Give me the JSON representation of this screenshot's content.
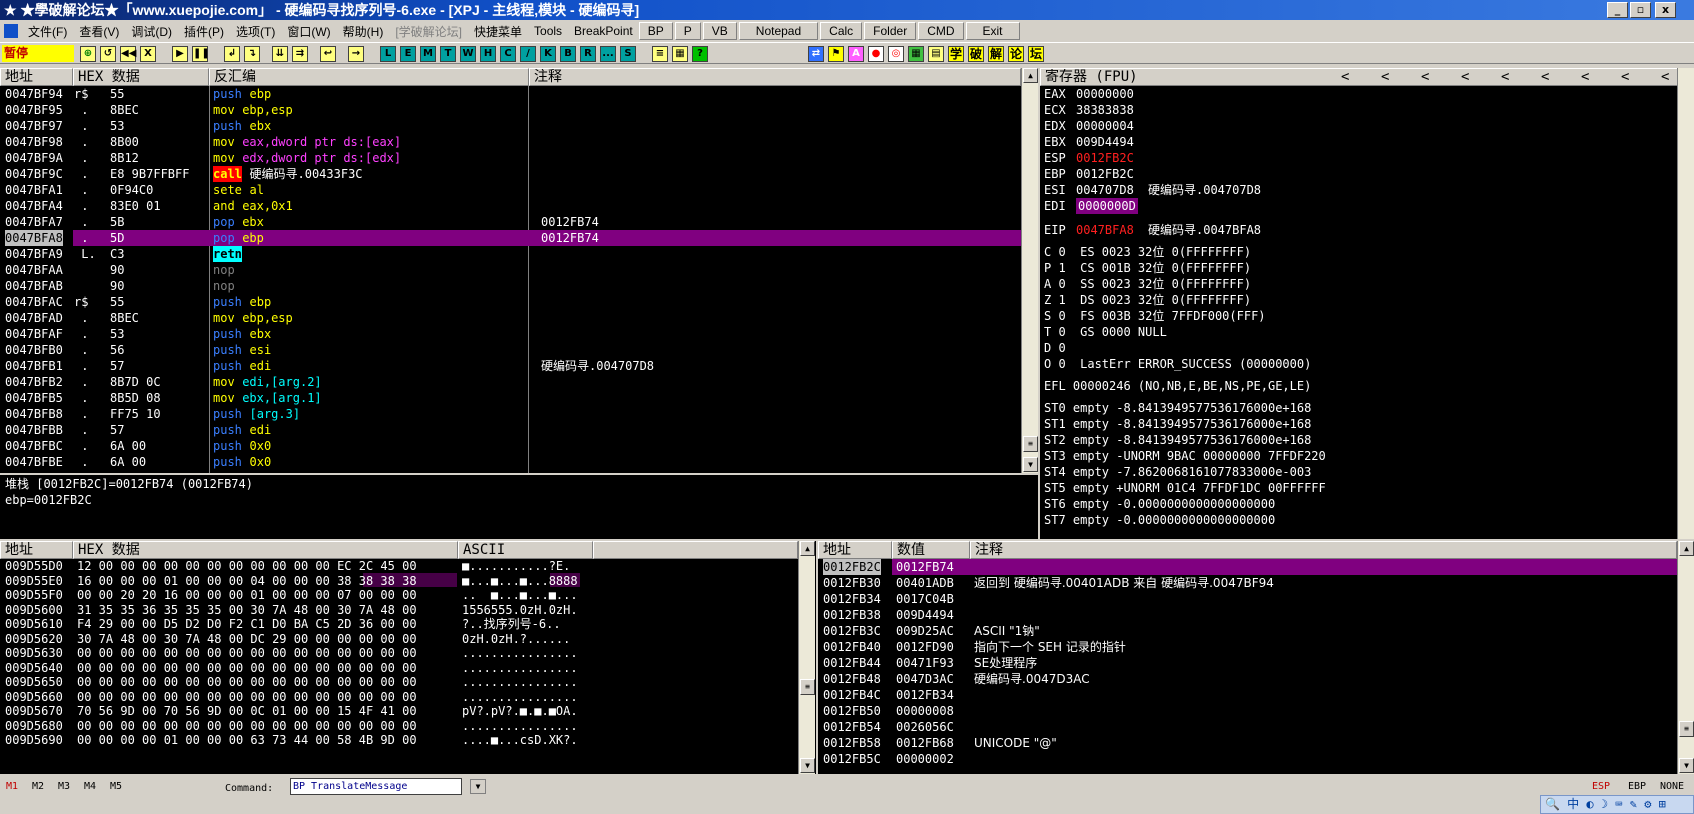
{
  "title": "★學破解论坛★「www.xuepojie.com」 - 硬编码寻找序列号-6.exe - [XPJ - 主线程,模块 - 硬编码寻]",
  "window_buttons": [
    "_",
    "▫",
    "x"
  ],
  "menu": [
    "文件(F)",
    "查看(V)",
    "调试(D)",
    "插件(P)",
    "选项(T)",
    "窗口(W)",
    "帮助(H)",
    "[学破解论坛]",
    "快捷菜单",
    "Tools",
    "BreakPoint"
  ],
  "menu_buttons": [
    "BP",
    "P",
    "VB",
    "Notepad",
    "Calc",
    "Folder",
    "CMD",
    "Exit"
  ],
  "status_paused": "暂停",
  "toolbar_letters": [
    "L",
    "E",
    "M",
    "T",
    "W",
    "H",
    "C",
    "/",
    "K",
    "B",
    "R",
    "...",
    "S"
  ],
  "toolbar_right": [
    "学",
    "破",
    "解",
    "论",
    "坛"
  ],
  "disasm": {
    "headers": [
      "地址",
      "HEX 数据",
      "反汇编",
      "注释"
    ],
    "rows": [
      {
        "addr": "0047BF94",
        "m": "r$",
        "hex": "55",
        "op": "push",
        "args": "ebp",
        "comment": ""
      },
      {
        "addr": "0047BF95",
        "m": " .",
        "hex": "8BEC",
        "op": "mov",
        "args": "ebp,esp",
        "comment": ""
      },
      {
        "addr": "0047BF97",
        "m": " .",
        "hex": "53",
        "op": "push",
        "args": "ebx",
        "comment": ""
      },
      {
        "addr": "0047BF98",
        "m": " .",
        "hex": "8B00",
        "op": "mov",
        "args": "eax,dword ptr ds:[eax]",
        "comment": ""
      },
      {
        "addr": "0047BF9A",
        "m": " .",
        "hex": "8B12",
        "op": "mov",
        "args": "edx,dword ptr ds:[edx]",
        "comment": ""
      },
      {
        "addr": "0047BF9C",
        "m": " .",
        "hex": "E8 9B7FFBFF",
        "op": "call",
        "args": "硬编码寻.00433F3C",
        "comment": ""
      },
      {
        "addr": "0047BFA1",
        "m": " .",
        "hex": "0F94C0",
        "op": "sete",
        "args": "al",
        "comment": ""
      },
      {
        "addr": "0047BFA4",
        "m": " .",
        "hex": "83E0 01",
        "op": "and",
        "args": "eax,0x1",
        "comment": ""
      },
      {
        "addr": "0047BFA7",
        "m": " .",
        "hex": "5B",
        "op": "pop",
        "args": "ebx",
        "comment": "0012FB74"
      },
      {
        "addr": "0047BFA8",
        "m": " .",
        "hex": "5D",
        "op": "pop",
        "args": "ebp",
        "comment": "0012FB74"
      },
      {
        "addr": "0047BFA9",
        "m": " L.",
        "hex": "C3",
        "op": "retn",
        "args": "",
        "comment": ""
      },
      {
        "addr": "0047BFAA",
        "m": "",
        "hex": "90",
        "op": "nop",
        "args": "",
        "comment": ""
      },
      {
        "addr": "0047BFAB",
        "m": "",
        "hex": "90",
        "op": "nop",
        "args": "",
        "comment": ""
      },
      {
        "addr": "0047BFAC",
        "m": "r$",
        "hex": "55",
        "op": "push",
        "args": "ebp",
        "comment": ""
      },
      {
        "addr": "0047BFAD",
        "m": " .",
        "hex": "8BEC",
        "op": "mov",
        "args": "ebp,esp",
        "comment": ""
      },
      {
        "addr": "0047BFAF",
        "m": " .",
        "hex": "53",
        "op": "push",
        "args": "ebx",
        "comment": ""
      },
      {
        "addr": "0047BFB0",
        "m": " .",
        "hex": "56",
        "op": "push",
        "args": "esi",
        "comment": ""
      },
      {
        "addr": "0047BFB1",
        "m": " .",
        "hex": "57",
        "op": "push",
        "args": "edi",
        "comment": "硬编码寻.004707D8"
      },
      {
        "addr": "0047BFB2",
        "m": " .",
        "hex": "8B7D 0C",
        "op": "mov",
        "args": "edi,[arg.2]",
        "comment": ""
      },
      {
        "addr": "0047BFB5",
        "m": " .",
        "hex": "8B5D 08",
        "op": "mov",
        "args": "ebx,[arg.1]",
        "comment": ""
      },
      {
        "addr": "0047BFB8",
        "m": " .",
        "hex": "FF75 10",
        "op": "push",
        "args": "[arg.3]",
        "comment": ""
      },
      {
        "addr": "0047BFBB",
        "m": " .",
        "hex": "57",
        "op": "push",
        "args": "edi",
        "comment": ""
      },
      {
        "addr": "0047BFBC",
        "m": " .",
        "hex": "6A 00",
        "op": "push",
        "args": "0x0",
        "comment": ""
      },
      {
        "addr": "0047BFBE",
        "m": " .",
        "hex": "6A 00",
        "op": "push",
        "args": "0x0",
        "comment": ""
      }
    ],
    "selected_row": 9
  },
  "info": {
    "line1": "堆栈 [0012FB2C]=0012FB74 (0012FB74)",
    "line2": "ebp=0012FB2C"
  },
  "registers": {
    "header": "寄存器 (FPU)",
    "arrows": [
      "<",
      "<",
      "<",
      "<",
      "<",
      "<",
      "<",
      "<",
      "<"
    ],
    "gp": [
      {
        "n": "EAX",
        "v": "00000000",
        "c": ""
      },
      {
        "n": "ECX",
        "v": "38383838",
        "c": ""
      },
      {
        "n": "EDX",
        "v": "00000004",
        "c": ""
      },
      {
        "n": "EBX",
        "v": "009D4494",
        "c": ""
      },
      {
        "n": "ESP",
        "v": "0012FB2C",
        "c": ""
      },
      {
        "n": "EBP",
        "v": "0012FB2C",
        "c": ""
      },
      {
        "n": "ESI",
        "v": "004707D8",
        "c": "硬编码寻.004707D8"
      },
      {
        "n": "EDI",
        "v": "0000000D",
        "c": ""
      }
    ],
    "eip": {
      "n": "EIP",
      "v": "0047BFA8",
      "c": "硬编码寻.0047BFA8"
    },
    "flags": [
      "C 0  ES 0023 32位 0(FFFFFFFF)",
      "P 1  CS 001B 32位 0(FFFFFFFF)",
      "A 0  SS 0023 32位 0(FFFFFFFF)",
      "Z 1  DS 0023 32位 0(FFFFFFFF)",
      "S 0  FS 003B 32位 7FFDF000(FFF)",
      "T 0  GS 0000 NULL",
      "D 0",
      "O 0  LastErr ERROR_SUCCESS (00000000)"
    ],
    "efl": "EFL 00000246 (NO,NB,E,BE,NS,PE,GE,LE)",
    "fpu": [
      "ST0 empty -8.8413949577536176000e+168",
      "ST1 empty -8.8413949577536176000e+168",
      "ST2 empty -8.8413949577536176000e+168",
      "ST3 empty -UNORM 9BAC 00000000 7FFDF220",
      "ST4 empty -7.8620068161077833000e-003",
      "ST5 empty +UNORM 01C4 7FFDF1DC 00FFFFFF",
      "ST6 empty -0.0000000000000000000",
      "ST7 empty -0.0000000000000000000"
    ]
  },
  "dump": {
    "headers": [
      "地址",
      "HEX 数据",
      "ASCII"
    ],
    "rows": [
      {
        "a": "009D55D0",
        "h": "12 00 00 00 00 00 00 00 00 00 00 00 EC 2C 45 00",
        "s": "■...........?E."
      },
      {
        "a": "009D55E0",
        "h": "16 00 00 00 01 00 00 00 04 00 00 00 38 38 38 38",
        "s": "■...■...■...8888"
      },
      {
        "a": "009D55F0",
        "h": "00 00 20 20 16 00 00 00 01 00 00 00 07 00 00 00",
        "s": "..  ■...■...■..."
      },
      {
        "a": "009D5600",
        "h": "31 35 35 36 35 35 35 00 30 7A 48 00 30 7A 48 00",
        "s": "1556555.0zH.0zH."
      },
      {
        "a": "009D5610",
        "h": "F4 29 00 00 D5 D2 D0 F2 C1 D0 BA C5 2D 36 00 00",
        "s": "?..找序列号-6.."
      },
      {
        "a": "009D5620",
        "h": "30 7A 48 00 30 7A 48 00 DC 29 00 00 00 00 00 00",
        "s": "0zH.0zH.?......"
      },
      {
        "a": "009D5630",
        "h": "00 00 00 00 00 00 00 00 00 00 00 00 00 00 00 00",
        "s": "................"
      },
      {
        "a": "009D5640",
        "h": "00 00 00 00 00 00 00 00 00 00 00 00 00 00 00 00",
        "s": "................"
      },
      {
        "a": "009D5650",
        "h": "00 00 00 00 00 00 00 00 00 00 00 00 00 00 00 00",
        "s": "................"
      },
      {
        "a": "009D5660",
        "h": "00 00 00 00 00 00 00 00 00 00 00 00 00 00 00 00",
        "s": "................"
      },
      {
        "a": "009D5670",
        "h": "70 56 9D 00 70 56 9D 00 0C 01 00 00 15 4F 41 00",
        "s": "pV?.pV?.■.■.■OA."
      },
      {
        "a": "009D5680",
        "h": "00 00 00 00 00 00 00 00 00 00 00 00 00 00 00 00",
        "s": "................"
      },
      {
        "a": "009D5690",
        "h": "00 00 00 00 01 00 00 00 63 73 44 00 58 4B 9D 00",
        "s": "....■...csD.XK?."
      }
    ]
  },
  "stack": {
    "headers": [
      "地址",
      "数值",
      "注释"
    ],
    "rows": [
      {
        "a": "0012FB2C",
        "v": "0012FB74",
        "c": ""
      },
      {
        "a": "0012FB30",
        "v": "00401ADB",
        "c": "返回到 硬编码寻.00401ADB 来自 硬编码寻.0047BF94"
      },
      {
        "a": "0012FB34",
        "v": "0017C04B",
        "c": ""
      },
      {
        "a": "0012FB38",
        "v": "009D4494",
        "c": ""
      },
      {
        "a": "0012FB3C",
        "v": "009D25AC",
        "c": "ASCII \"1钠\""
      },
      {
        "a": "0012FB40",
        "v": "0012FD90",
        "c": "指向下一个 SEH 记录的指针"
      },
      {
        "a": "0012FB44",
        "v": "00471F93",
        "c": "SE处理程序"
      },
      {
        "a": "0012FB48",
        "v": "0047D3AC",
        "c": "硬编码寻.0047D3AC"
      },
      {
        "a": "0012FB4C",
        "v": "0012FB34",
        "c": ""
      },
      {
        "a": "0012FB50",
        "v": "00000008",
        "c": ""
      },
      {
        "a": "0012FB54",
        "v": "0026056C",
        "c": ""
      },
      {
        "a": "0012FB58",
        "v": "0012FB68",
        "c": "UNICODE \"@\""
      },
      {
        "a": "0012FB5C",
        "v": "00000002",
        "c": ""
      }
    ]
  },
  "status": {
    "tabs": [
      "M1",
      "M2",
      "M3",
      "M4",
      "M5"
    ],
    "command_label": "Command:",
    "command_value": "BP TranslateMessage",
    "regs": [
      "ESP",
      "EBP",
      "NONE"
    ]
  }
}
